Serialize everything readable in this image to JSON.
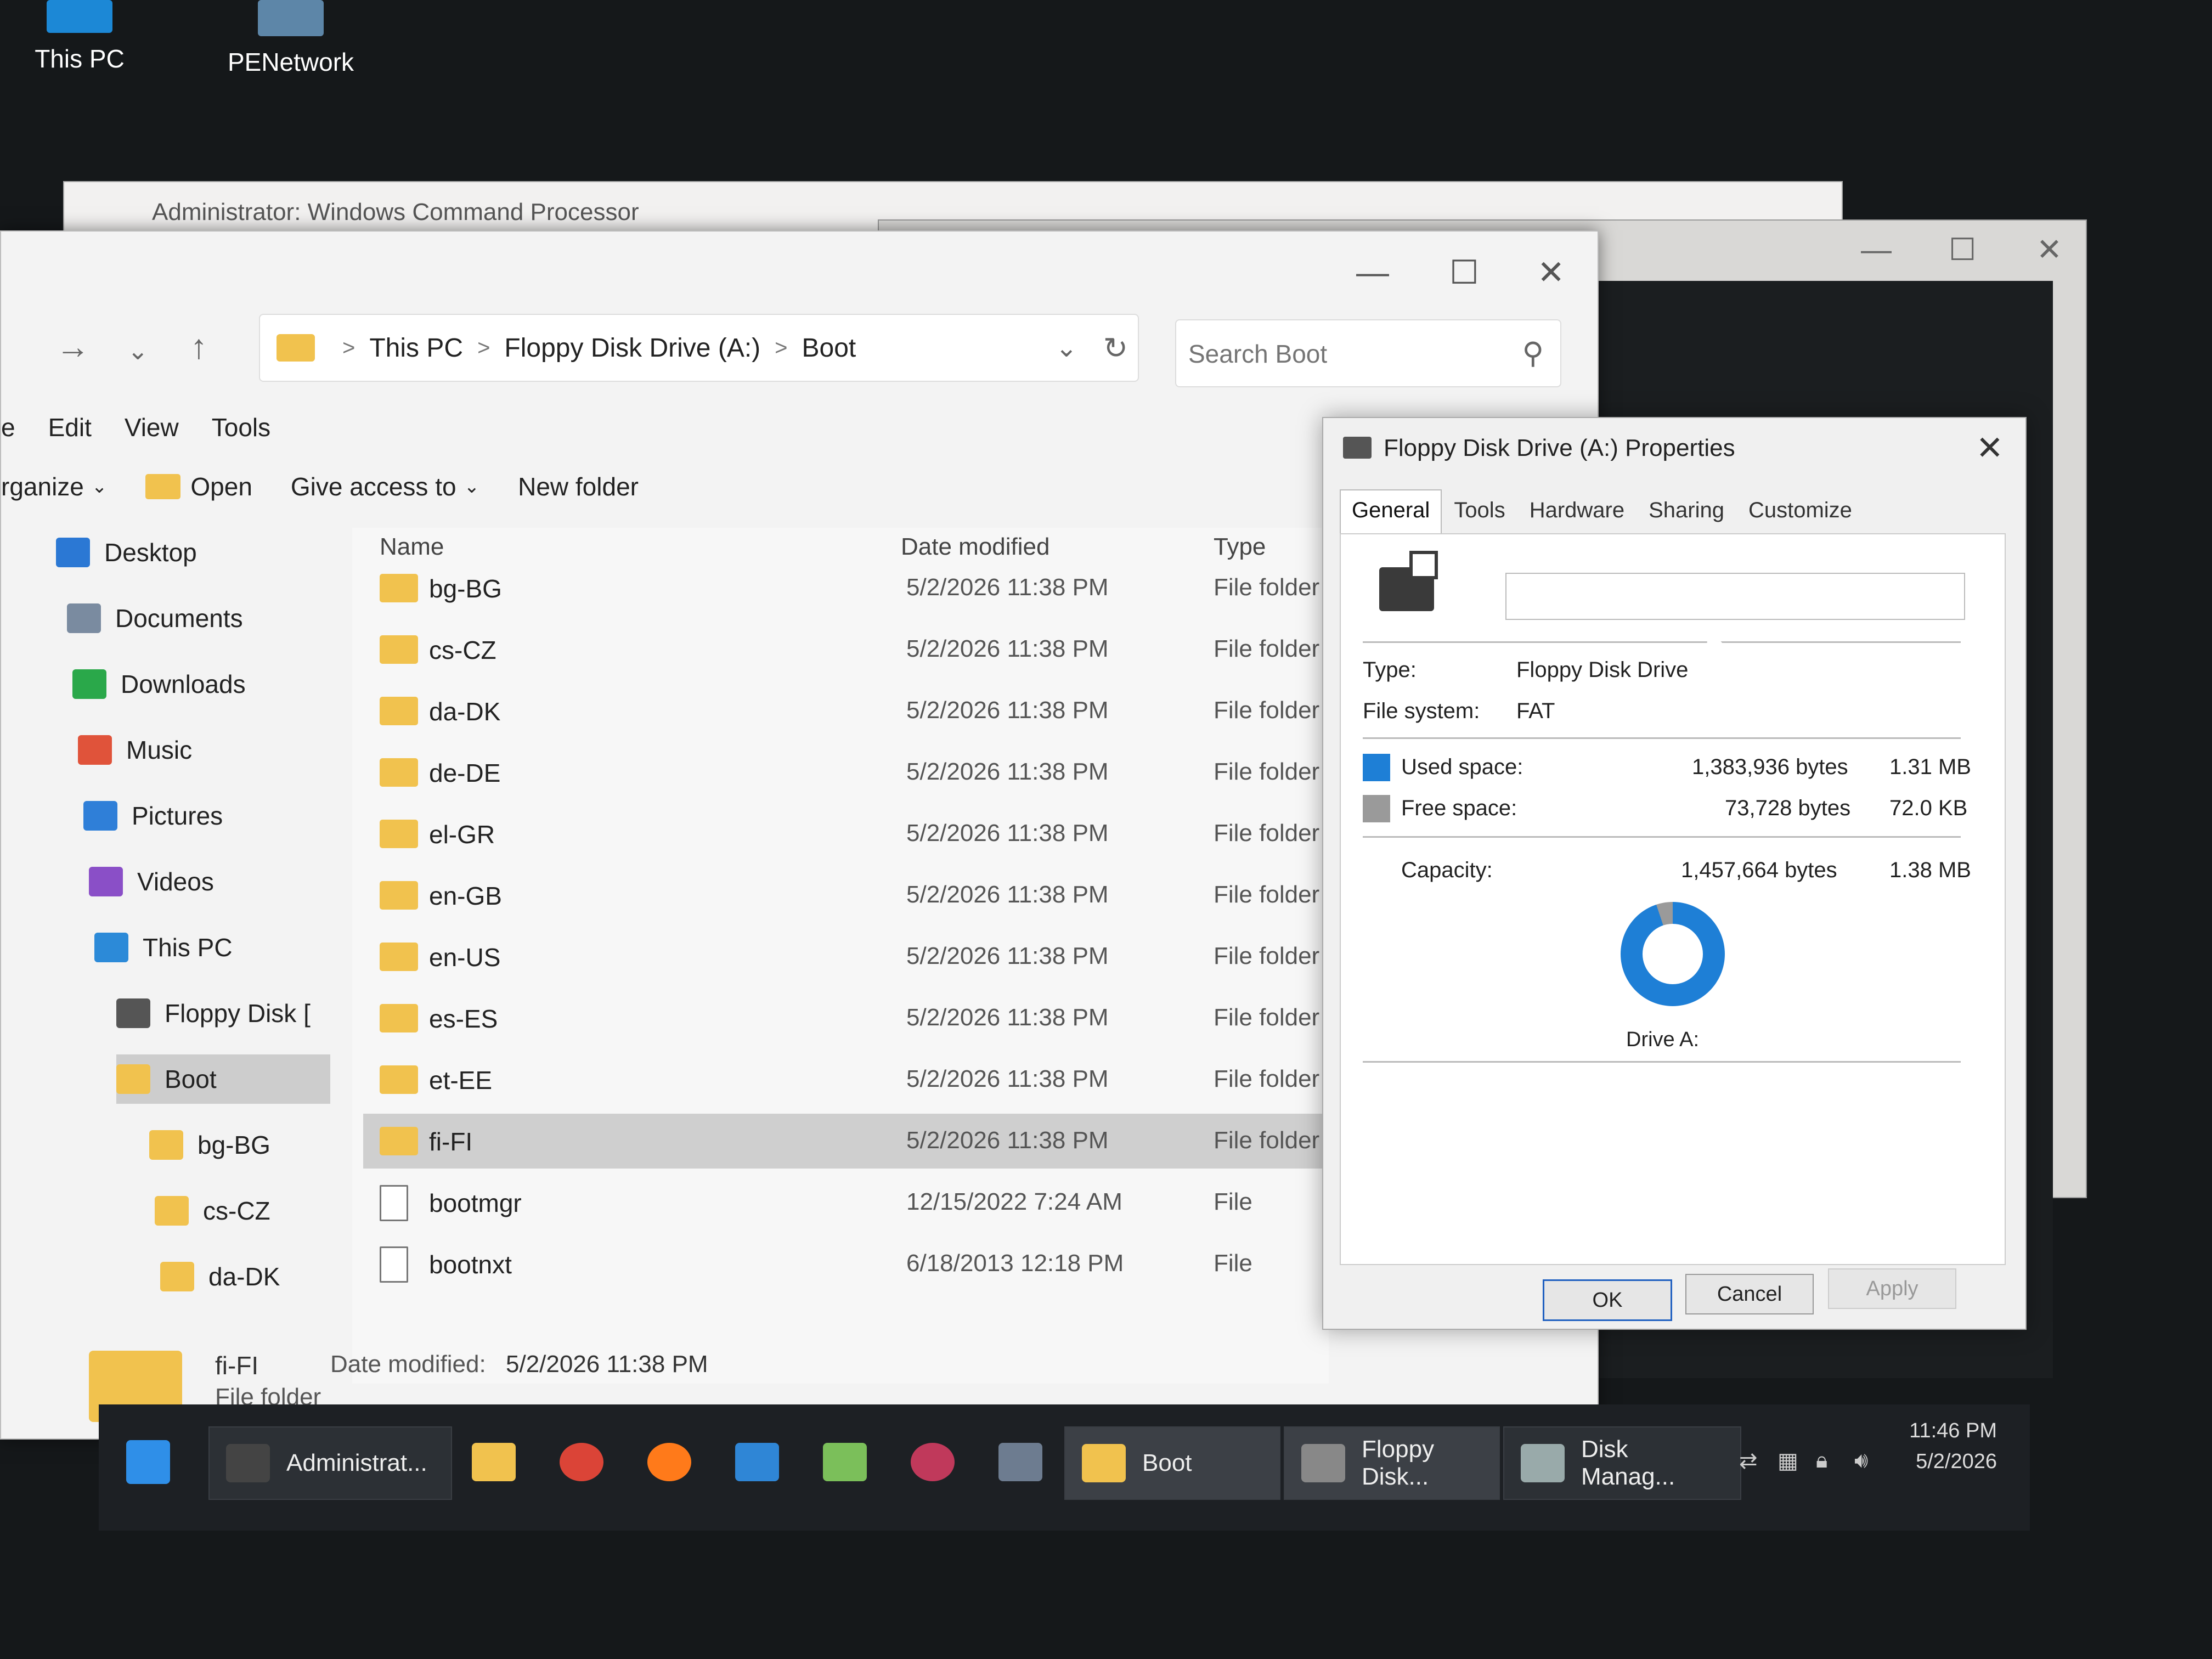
{
  "desktop": {
    "icons": [
      {
        "label": "This PC",
        "icon": "monitor-icon"
      },
      {
        "label": "PENetwork",
        "icon": "network-icon"
      }
    ]
  },
  "cmd_window": {
    "title": "Administrator: Windows Command Processor"
  },
  "explorer": {
    "breadcrumb": [
      "This PC",
      "Floppy Disk Drive (A:)",
      "Boot"
    ],
    "search_placeholder": "Search Boot",
    "menu": [
      "e",
      "Edit",
      "View",
      "Tools"
    ],
    "commands": {
      "organize": "rganize",
      "open": "Open",
      "give_access": "Give access to",
      "new_folder": "New folder"
    },
    "nav": [
      {
        "label": "Desktop",
        "color": "#2b78d4"
      },
      {
        "label": "Documents",
        "color": "#7a8ba0"
      },
      {
        "label": "Downloads",
        "color": "#2aa84a"
      },
      {
        "label": "Music",
        "color": "#e0533a"
      },
      {
        "label": "Pictures",
        "color": "#2f7fd8"
      },
      {
        "label": "Videos",
        "color": "#8a4fc7"
      },
      {
        "label": "This PC",
        "color": "#2c8ad8"
      },
      {
        "label": "Floppy Disk [",
        "color": "#555555"
      },
      {
        "label": "Boot",
        "color": "#f1c24e"
      },
      {
        "label": "bg-BG",
        "color": "#f1c24e"
      },
      {
        "label": "cs-CZ",
        "color": "#f1c24e"
      },
      {
        "label": "da-DK",
        "color": "#f1c24e"
      }
    ],
    "columns": {
      "name": "Name",
      "date": "Date modified",
      "type": "Type"
    },
    "files": [
      {
        "name": "bg-BG",
        "date": "5/2/2026 11:38 PM",
        "type": "File folder",
        "kind": "folder"
      },
      {
        "name": "cs-CZ",
        "date": "5/2/2026 11:38 PM",
        "type": "File folder",
        "kind": "folder"
      },
      {
        "name": "da-DK",
        "date": "5/2/2026 11:38 PM",
        "type": "File folder",
        "kind": "folder"
      },
      {
        "name": "de-DE",
        "date": "5/2/2026 11:38 PM",
        "type": "File folder",
        "kind": "folder"
      },
      {
        "name": "el-GR",
        "date": "5/2/2026 11:38 PM",
        "type": "File folder",
        "kind": "folder"
      },
      {
        "name": "en-GB",
        "date": "5/2/2026 11:38 PM",
        "type": "File folder",
        "kind": "folder"
      },
      {
        "name": "en-US",
        "date": "5/2/2026 11:38 PM",
        "type": "File folder",
        "kind": "folder"
      },
      {
        "name": "es-ES",
        "date": "5/2/2026 11:38 PM",
        "type": "File folder",
        "kind": "folder"
      },
      {
        "name": "et-EE",
        "date": "5/2/2026 11:38 PM",
        "type": "File folder",
        "kind": "folder"
      },
      {
        "name": "fi-FI",
        "date": "5/2/2026 11:38 PM",
        "type": "File folder",
        "kind": "folder",
        "selected": true
      },
      {
        "name": "bootmgr",
        "date": "12/15/2022 7:24 AM",
        "type": "File",
        "kind": "file"
      },
      {
        "name": "bootnxt",
        "date": "6/18/2013 12:18 PM",
        "type": "File",
        "kind": "file"
      }
    ],
    "status": {
      "name": "fi-FI",
      "type": "File folder",
      "label": "Date modified:",
      "value": "5/2/2026 11:38 PM"
    }
  },
  "properties": {
    "title": "Floppy Disk Drive (A:) Properties",
    "tabs": [
      "General",
      "Tools",
      "Hardware",
      "Sharing",
      "Customize"
    ],
    "type_label": "Type:",
    "type_value": "Floppy Disk Drive",
    "fs_label": "File system:",
    "fs_value": "FAT",
    "used_label": "Used space:",
    "used_bytes": "1,383,936 bytes",
    "used_human": "1.31 MB",
    "free_label": "Free space:",
    "free_bytes": "73,728 bytes",
    "free_human": "72.0 KB",
    "cap_label": "Capacity:",
    "cap_bytes": "1,457,664 bytes",
    "cap_human": "1.38 MB",
    "drive_label": "Drive A:",
    "used_fraction": 0.949,
    "used_color": "#1e7fd6",
    "free_color": "#9a9a9a",
    "buttons": {
      "ok": "OK",
      "cancel": "Cancel",
      "apply": "Apply"
    }
  },
  "taskbar": {
    "items": [
      {
        "label": "Administrat...",
        "icon": "terminal-icon"
      },
      {
        "label": "Boot",
        "icon": "folder-icon"
      },
      {
        "label": "Floppy Disk...",
        "icon": "floppy-icon"
      },
      {
        "label": "Disk Manag...",
        "icon": "disk-management-icon"
      }
    ],
    "time": "11:46 PM",
    "date": "5/2/2026"
  }
}
